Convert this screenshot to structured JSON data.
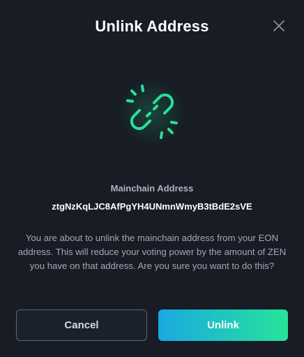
{
  "modal": {
    "title": "Unlink Address",
    "close_icon": "close-icon",
    "hero_icon": "broken-link-icon",
    "accent_color": "#26e295"
  },
  "address": {
    "label": "Mainchain Address",
    "value": "ztgNzKqLJC8AfPgYH4UNmnWmyB3tBdE2sVE"
  },
  "message": "You are about to unlink the mainchain address from your EON address. This will reduce your voting power by the amount of ZEN you have on that address. Are you sure you want to do this?",
  "buttons": {
    "cancel_label": "Cancel",
    "unlink_label": "Unlink",
    "unlink_gradient": [
      "#1aa9e1",
      "#27e39a"
    ]
  }
}
